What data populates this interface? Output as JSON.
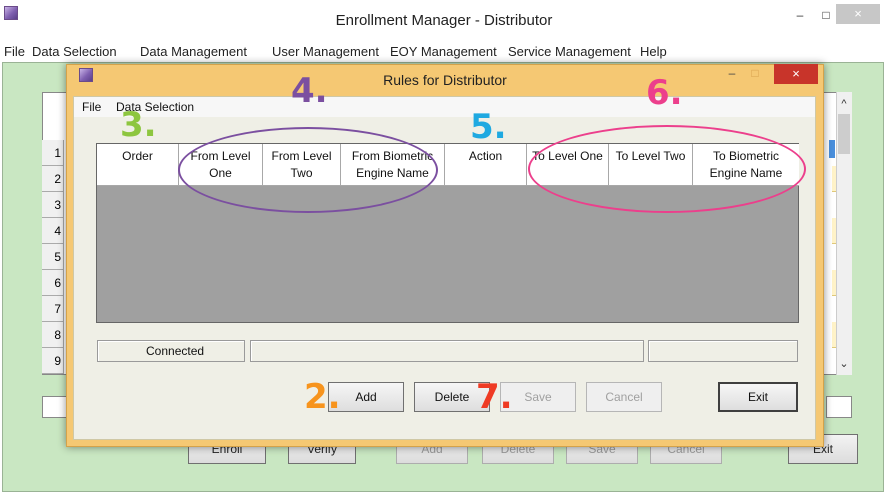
{
  "main_window": {
    "title": "Enrollment Manager - Distributor",
    "minimize_glyph": "–",
    "maximize_glyph": "□",
    "close_glyph": "×",
    "menu": [
      "File",
      "Data Selection",
      "Data Management",
      "User Management",
      "EOY Management",
      "Service Management",
      "Help"
    ],
    "row_numbers": [
      "1",
      "2",
      "3",
      "4",
      "5",
      "6",
      "7",
      "8",
      "9"
    ],
    "scroll_up_glyph": "^",
    "scroll_down_glyph": "⌄",
    "buttons": {
      "enroll": "Enroll",
      "verify": "Verify",
      "add": "Add",
      "delete": "Delete",
      "save": "Save",
      "cancel": "Cancel",
      "exit": "Exit"
    }
  },
  "dialog": {
    "title": "Rules for Distributor",
    "minimize_glyph": "–",
    "maximize_glyph": "□",
    "close_glyph": "×",
    "menu": [
      "File",
      "Data Selection"
    ],
    "columns": [
      {
        "label": "Order"
      },
      {
        "label": "From Level One"
      },
      {
        "label": "From Level Two"
      },
      {
        "label": "From Biometric Engine Name"
      },
      {
        "label": "Action"
      },
      {
        "label": "To Level One"
      },
      {
        "label": "To Level Two"
      },
      {
        "label": "To Biometric Engine Name"
      }
    ],
    "status": {
      "connection": "Connected",
      "message": "",
      "extra": ""
    },
    "buttons": {
      "add": "Add",
      "delete": "Delete",
      "save": "Save",
      "cancel": "Cancel",
      "exit": "Exit"
    }
  },
  "annotations": {
    "labels": [
      "2.",
      "3.",
      "4.",
      "5.",
      "6.",
      "7."
    ],
    "colors": {
      "2": "#f7941d",
      "3": "#8dc63f",
      "4": "#7b4fa0",
      "5": "#1fa9e1",
      "6": "#ec3f8c",
      "7": "#ef3b24"
    }
  }
}
